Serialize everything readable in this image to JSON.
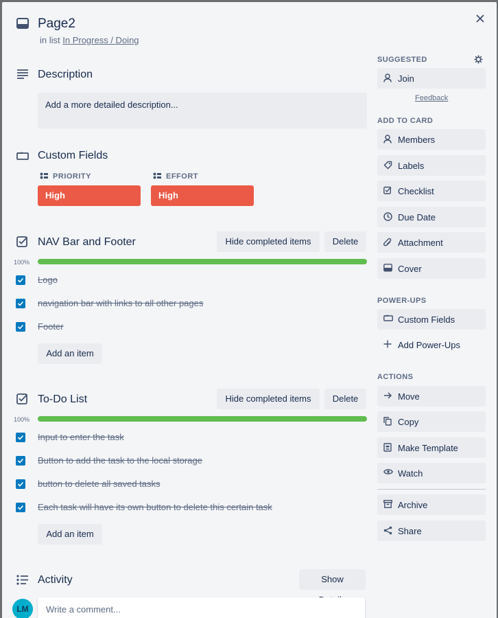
{
  "card": {
    "title": "Page2",
    "in_list_prefix": "in list",
    "list_name": "In Progress / Doing"
  },
  "description": {
    "heading": "Description",
    "placeholder": "Add a more detailed description..."
  },
  "custom_fields": {
    "heading": "Custom Fields",
    "fields": [
      {
        "label": "PRIORITY",
        "value": "High"
      },
      {
        "label": "EFFORT",
        "value": "High"
      }
    ],
    "value_color": "#eb5a46"
  },
  "checklists": [
    {
      "title": "NAV Bar and Footer",
      "hide_label": "Hide completed items",
      "delete_label": "Delete",
      "progress_text": "100%",
      "progress": 1.0,
      "items": [
        "Logo",
        "navigation bar with links to all other pages",
        "Footer"
      ],
      "add_item_label": "Add an item"
    },
    {
      "title": "To-Do List",
      "hide_label": "Hide completed items",
      "delete_label": "Delete",
      "progress_text": "100%",
      "progress": 1.0,
      "items": [
        "Input to enter the task",
        "Button to add the task to the local storage",
        "button to delete all saved tasks",
        "Each task will have its own button to delete this certain task"
      ],
      "add_item_label": "Add an item"
    }
  ],
  "activity": {
    "heading": "Activity",
    "show_details_label": "Show Details",
    "avatar_initials": "LM",
    "comment_placeholder": "Write a comment..."
  },
  "sidebar": {
    "suggested_heading": "SUGGESTED",
    "join_label": "Join",
    "feedback_label": "Feedback",
    "add_to_card_heading": "ADD TO CARD",
    "add_to_card": [
      "Members",
      "Labels",
      "Checklist",
      "Due Date",
      "Attachment",
      "Cover"
    ],
    "powerups_heading": "POWER-UPS",
    "custom_fields_label": "Custom Fields",
    "add_powerups_label": "Add Power-Ups",
    "actions_heading": "ACTIONS",
    "actions": [
      "Move",
      "Copy",
      "Make Template",
      "Watch"
    ],
    "archive_label": "Archive",
    "share_label": "Share"
  },
  "colors": {
    "progress": "#61bd4f",
    "checkbox": "#0079bf",
    "avatar": "#00aecc"
  },
  "icons": {
    "close": "close-icon",
    "card": "card-icon",
    "description": "description-icon",
    "custom_fields": "custom-fields-icon",
    "checklist": "checklist-icon",
    "activity": "activity-icon"
  }
}
